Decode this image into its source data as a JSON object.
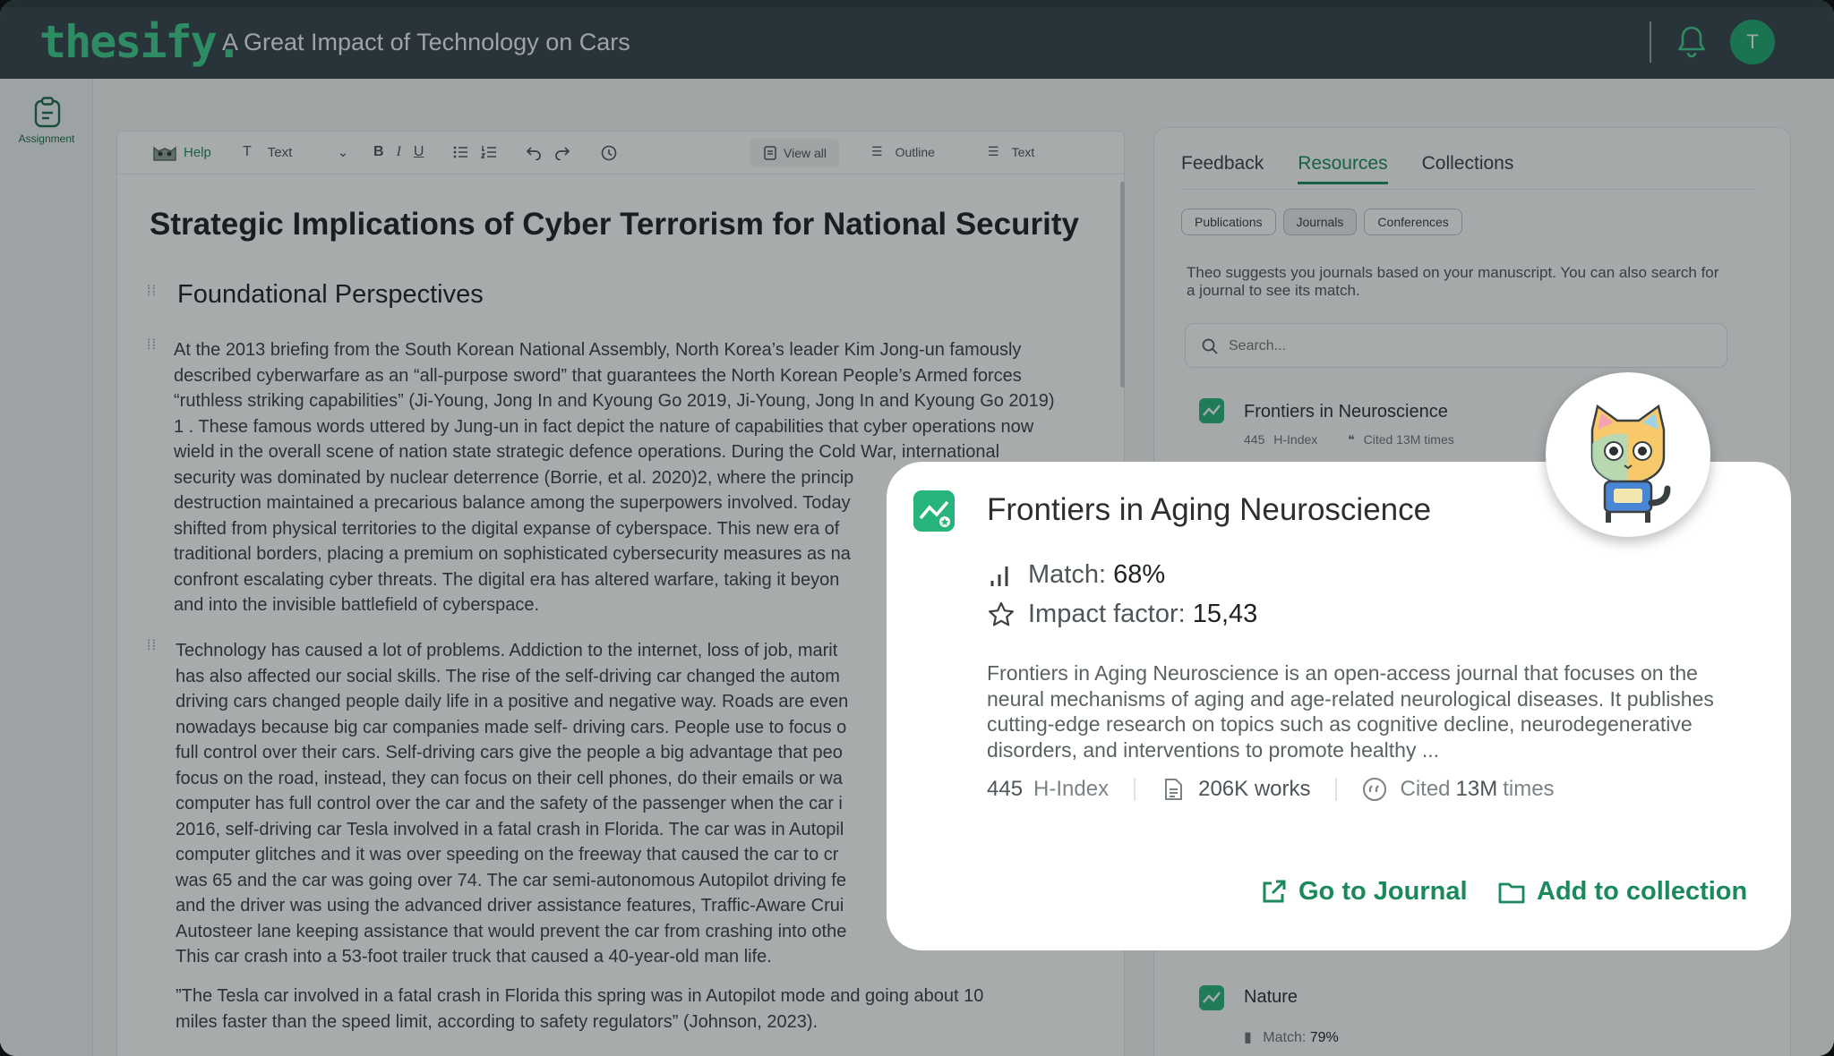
{
  "app": {
    "logo": "thesify.",
    "document_title": "A Great Impact of Technology on Cars",
    "avatar_initial": "T"
  },
  "rail": {
    "assignment_label": "Assignment"
  },
  "toolbar": {
    "help": "Help",
    "text_style": "Text",
    "view_all": "View all",
    "outline": "Outline",
    "text_view": "Text"
  },
  "editor": {
    "title": "Strategic Implications of Cyber Terrorism for National Security",
    "section_heading": "Foundational Perspectives",
    "para1": [
      "At the 2013 briefing from the South Korean National Assembly, North Korea’s leader Kim Jong-un famously",
      "described cyberwarfare as an “all-purpose sword” that guarantees the North Korean People’s Armed forces",
      "“ruthless striking capabilities” (Ji-Young, Jong In and Kyoung Go 2019, Ji-Young, Jong In and Kyoung Go 2019)",
      "1 . These famous words uttered by Jung-un in fact depict the nature of capabilities that cyber operations now",
      "wield in the overall scene of nation state strategic defence operations. During the Cold War, international",
      "security was dominated by nuclear deterrence (Borrie, et al. 2020)2, where the princip",
      "destruction maintained a precarious balance among the superpowers involved. Today",
      "shifted from physical territories to the digital expanse of cyberspace. This new era of",
      "traditional borders, placing a premium on sophisticated cybersecurity measures as na",
      "confront escalating cyber threats. The digital era has altered warfare, taking it beyon",
      "and into the invisible battlefield of cyberspace."
    ],
    "para2": [
      "Technology has caused a lot of problems. Addiction to the internet, loss of job, marit",
      "has also affected our social skills. The rise of the self-driving car changed the autom",
      "driving cars changed people daily life in a positive and negative way. Roads are even",
      "nowadays because big car companies made self- driving cars. People use to focus o",
      "full control over their cars. Self-driving cars give the people a big advantage that peo",
      "focus on the road, instead, they can focus on their cell phones, do their emails or wa",
      "computer has full control over the car and the safety of the passenger when the car i",
      "2016, self-driving car Tesla involved in a fatal crash in Florida. The car was in Autopil",
      "computer glitches and it was over speeding on the freeway that caused the car to cr",
      "was 65 and the car was going over 74. The car semi-autonomous Autopilot driving fe",
      "and the driver was using the advanced driver assistance features, Traffic-Aware Crui",
      "Autosteer lane keeping assistance that would prevent the car from crashing into othe",
      "This car crash into a 53-foot trailer truck that caused a 40-year-old man life."
    ],
    "para3": [
      "”The Tesla car involved in a fatal crash in Florida this spring was in Autopilot mode and going about 10",
      "miles faster than the speed limit, according to safety regulators” (Johnson, 2023)."
    ]
  },
  "panel": {
    "tabs": [
      "Feedback",
      "Resources",
      "Collections"
    ],
    "active_tab": "Resources",
    "chips": [
      "Publications",
      "Journals",
      "Conferences"
    ],
    "selected_chip": "Journals",
    "suggestion": "Theo suggests you journals based on your manuscript. You can also search for a journal to see its match.",
    "search_placeholder": "Search...",
    "journals": [
      {
        "name": "Frontiers in Neuroscience",
        "h_index": "445",
        "h_index_label": "H-Index",
        "cited": "Cited 13M times"
      },
      {
        "name": "Nature",
        "match_label": "Match:",
        "match_value": "79%"
      }
    ]
  },
  "card": {
    "title": "Frontiers in Aging Neuroscience",
    "match_label": "Match:",
    "match_value": "68%",
    "impact_label": "Impact factor:",
    "impact_value": "15,43",
    "description": "Frontiers in Aging Neuroscience is an open-access journal that focuses on the neural mechanisms of aging and age-related neurological diseases. It publishes cutting-edge research on topics such as cognitive decline, neurodegenerative disorders, and interventions to promote healthy ...",
    "h_index": "445",
    "h_index_label": "H-Index",
    "works": "206K works",
    "cited_prefix": "Cited",
    "cited_value": "13M",
    "cited_suffix": "times",
    "go_to_journal": "Go to Journal",
    "add_to_collection": "Add to collection"
  },
  "colors": {
    "accent": "#1a8a5c",
    "logo": "#3fcf8e",
    "topbar": "#35434a"
  }
}
